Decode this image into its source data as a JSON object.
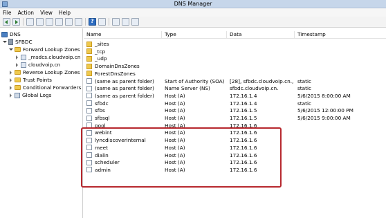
{
  "window": {
    "title": "DNS Manager"
  },
  "menu": [
    "File",
    "Action",
    "View",
    "Help"
  ],
  "tree": {
    "root": "DNS",
    "server": "SFBDC",
    "forward": "Forward Lookup Zones",
    "zone_msdcs": "_msdcs.cloudvoip.cn",
    "zone_cloudvoip": "cloudvoip.cn",
    "reverse": "Reverse Lookup Zones",
    "trust": "Trust Points",
    "conditional": "Conditional Forwarders",
    "logs": "Global Logs"
  },
  "columns": {
    "name": "Name",
    "type": "Type",
    "data": "Data",
    "timestamp": "Timestamp"
  },
  "rows": [
    {
      "name": "_sites",
      "type": "",
      "data": "",
      "timestamp": "",
      "kind": "folder"
    },
    {
      "name": "_tcp",
      "type": "",
      "data": "",
      "timestamp": "",
      "kind": "folder"
    },
    {
      "name": "_udp",
      "type": "",
      "data": "",
      "timestamp": "",
      "kind": "folder"
    },
    {
      "name": "DomainDnsZones",
      "type": "",
      "data": "",
      "timestamp": "",
      "kind": "folder"
    },
    {
      "name": "ForestDnsZones",
      "type": "",
      "data": "",
      "timestamp": "",
      "kind": "folder"
    },
    {
      "name": "(same as parent folder)",
      "type": "Start of Authority (SOA)",
      "data": "[28], sfbdc.cloudvoip.cn.,",
      "timestamp": "static",
      "kind": "record"
    },
    {
      "name": "(same as parent folder)",
      "type": "Name Server (NS)",
      "data": "sfbdc.cloudvoip.cn.",
      "timestamp": "static",
      "kind": "record"
    },
    {
      "name": "(same as parent folder)",
      "type": "Host (A)",
      "data": "172.16.1.4",
      "timestamp": "5/6/2015 8:00:00 AM",
      "kind": "record"
    },
    {
      "name": "sfbdc",
      "type": "Host (A)",
      "data": "172.16.1.4",
      "timestamp": "static",
      "kind": "record"
    },
    {
      "name": "sfbs",
      "type": "Host (A)",
      "data": "172.16.1.5",
      "timestamp": "5/6/2015 12:00:00 PM",
      "kind": "record"
    },
    {
      "name": "sfbsql",
      "type": "Host (A)",
      "data": "172.16.1.5",
      "timestamp": "5/6/2015 9:00:00 AM",
      "kind": "record"
    },
    {
      "name": "pool",
      "type": "Host (A)",
      "data": "172.16.1.6",
      "timestamp": "",
      "kind": "record"
    },
    {
      "name": "webint",
      "type": "Host (A)",
      "data": "172.16.1.6",
      "timestamp": "",
      "kind": "record"
    },
    {
      "name": "lyncdiscoverinternal",
      "type": "Host (A)",
      "data": "172.16.1.6",
      "timestamp": "",
      "kind": "record"
    },
    {
      "name": "meet",
      "type": "Host (A)",
      "data": "172.16.1.6",
      "timestamp": "",
      "kind": "record"
    },
    {
      "name": "dialin",
      "type": "Host (A)",
      "data": "172.16.1.6",
      "timestamp": "",
      "kind": "record"
    },
    {
      "name": "scheduler",
      "type": "Host (A)",
      "data": "172.16.1.6",
      "timestamp": "",
      "kind": "record"
    },
    {
      "name": "admin",
      "type": "Host (A)",
      "data": "172.16.1.6",
      "timestamp": "",
      "kind": "record"
    }
  ],
  "colors": {
    "titlebar": "#c6d6ea",
    "highlight_box": "#b7282e",
    "folder": "#efc94c"
  }
}
